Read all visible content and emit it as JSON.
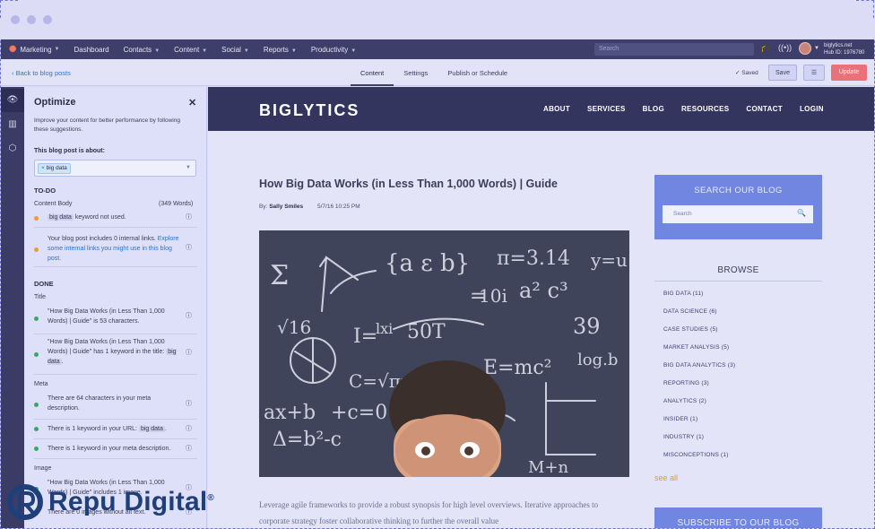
{
  "topnav": {
    "brand": "Marketing",
    "items": [
      "Dashboard",
      "Contacts",
      "Content",
      "Social",
      "Reports",
      "Productivity"
    ],
    "search_placeholder": "Search",
    "account_name": "biglytics.net",
    "hub_id": "Hub ID: 1976780"
  },
  "toolbar": {
    "back_label": "‹ Back to blog posts",
    "tabs": [
      "Content",
      "Settings",
      "Publish or Schedule"
    ],
    "saved_label": "✓ Saved",
    "save_label": "Save",
    "update_label": "Update"
  },
  "optimize": {
    "title": "Optimize",
    "description": "Improve your content for better performance by following these suggestions.",
    "about_label": "This blog post is about:",
    "keyword_tag": "big data",
    "todo_label": "TO-DO",
    "content_body_label": "Content Body",
    "word_count": "(349 Words)",
    "todo_items": {
      "kw_chip": "big data",
      "kw_text": "keyword not used.",
      "links_text": "Your blog post includes 0 internal links.",
      "links_link": "Explore some internal links you might use in this blog post."
    },
    "done_label": "DONE",
    "title_section": "Title",
    "title_item1": "\"How Big Data Works (in Less Than 1,000 Words) | Guide\" is 53 characters.",
    "title_item2": "\"How Big Data Works (in Less Than 1,000 Words) | Guide\" has 1 keyword in the title:",
    "title_item2_kw": "big data",
    "meta_section": "Meta",
    "meta_item1": "There are 64 characters in your meta description.",
    "meta_item2_pre": "There is 1 keyword in your URL:",
    "meta_item2_kw": "big data",
    "meta_item3": "There is 1 keyword in your meta description.",
    "image_section": "Image",
    "image_item1": "\"How Big Data Works (in Less Than 1,000 Words) | Guide\" includes 1 image.",
    "image_item2": "There are 0 images without alt text."
  },
  "blog": {
    "logo": "BIGLYTICS",
    "nav": [
      "ABOUT",
      "SERVICES",
      "BLOG",
      "RESOURCES",
      "CONTACT",
      "LOGIN"
    ],
    "post_title": "How Big Data Works (in Less Than 1,000 Words) | Guide",
    "by_prefix": "By:",
    "author": "Sally Smiles",
    "date": "5/7/16 10:25 PM",
    "body": "Leverage agile frameworks to provide a robust synopsis for high level overviews. Iterative approaches to corporate strategy foster collaborative thinking to further the overall value",
    "search_title": "SEARCH OUR BLOG",
    "search_placeholder": "Search",
    "browse_title": "BROWSE",
    "categories": [
      "BIG DATA (11)",
      "DATA SCIENCE (6)",
      "CASE STUDIES (5)",
      "MARKET ANALYSIS (5)",
      "BIG DATA ANALYTICS (3)",
      "REPORTING (3)",
      "ANALYTICS (2)",
      "INSIDER (1)",
      "INDUSTRY (1)",
      "MISCONCEPTIONS (1)"
    ],
    "see_all": "see all",
    "subscribe": "SUBSCRIBE TO OUR BLOG"
  },
  "watermark": {
    "text": "Repu Digital",
    "reg": "®"
  },
  "colors": {
    "nav": "#3d3f6a",
    "accent": "#e97179",
    "link": "#2f73c8",
    "todo": "#e89b3f",
    "done": "#3ca66a"
  }
}
